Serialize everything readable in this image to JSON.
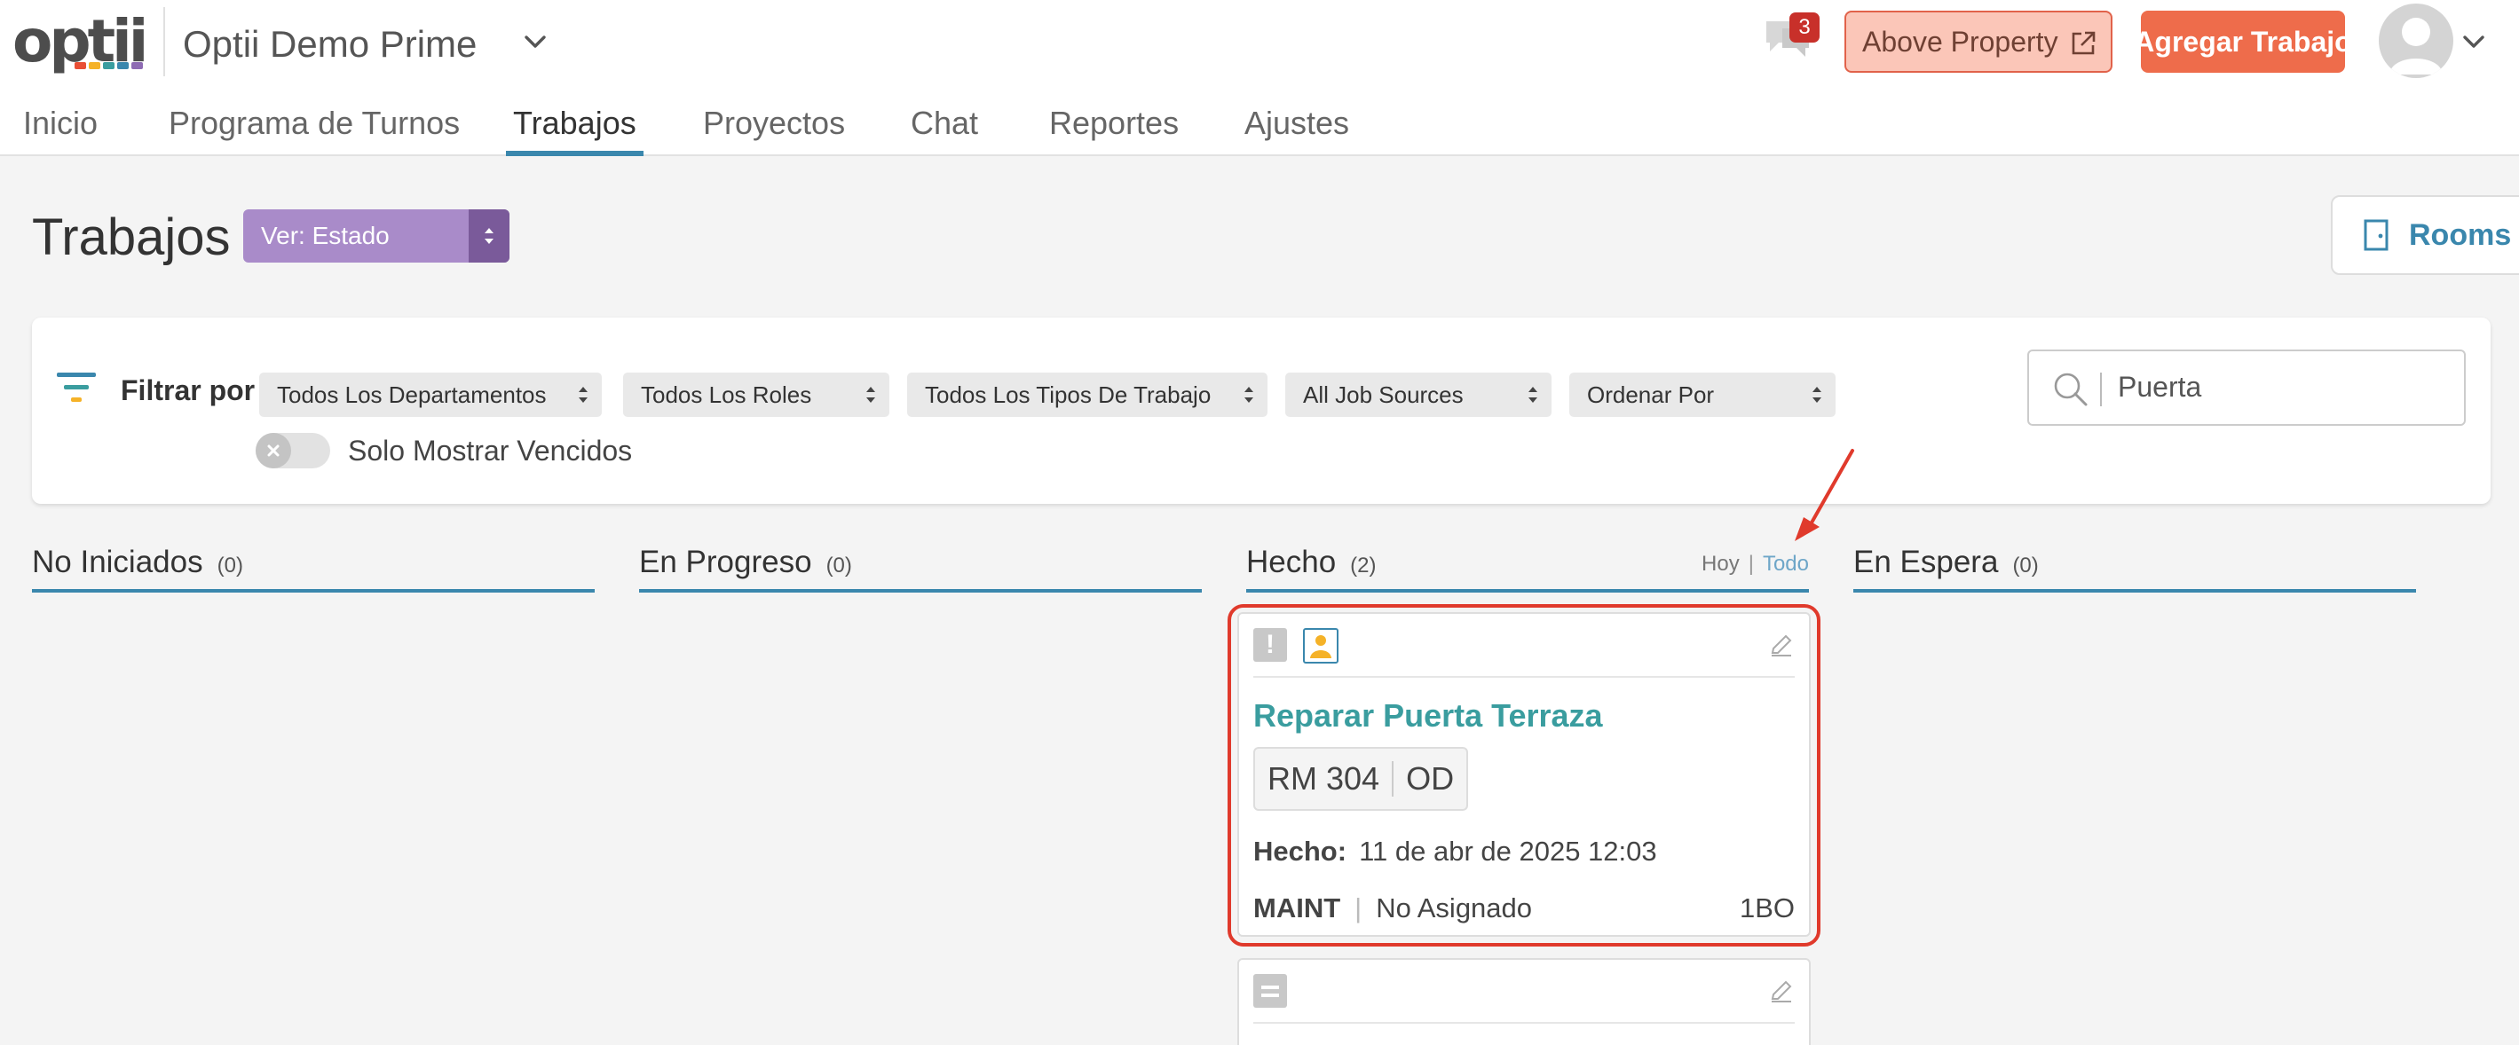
{
  "header": {
    "logo_text": "optii",
    "logo_colors": [
      "#e94f35",
      "#f5b228",
      "#3a9d9f",
      "#3a87ad",
      "#8e6bb3"
    ],
    "property_name": "Optii Demo Prime",
    "chat_badge_count": "3",
    "above_property_label": "Above Property",
    "add_job_label": "Agregar Trabajo"
  },
  "nav": {
    "items": [
      "Inicio",
      "Programa de Turnos",
      "Trabajos",
      "Proyectos",
      "Chat",
      "Reportes",
      "Ajustes"
    ],
    "active": "Trabajos"
  },
  "page": {
    "title": "Trabajos",
    "view_select": "Ver: Estado",
    "rooms_label": "Rooms"
  },
  "filters": {
    "label": "Filtrar por",
    "selects": [
      "Todos Los Departamentos",
      "Todos Los Roles",
      "Todos Los Tipos De Trabajo",
      "All Job Sources",
      "Ordenar Por"
    ],
    "overdue_toggle_label": "Solo Mostrar Vencidos",
    "overdue_toggle_on": false,
    "search_value": "Puerta"
  },
  "columns": [
    {
      "title": "No Iniciados",
      "count": "(0)"
    },
    {
      "title": "En Progreso",
      "count": "(0)"
    },
    {
      "title": "Hecho",
      "count": "(2)",
      "link_today": "Hoy",
      "link_separator": "|",
      "link_all": "Todo"
    },
    {
      "title": "En Espera",
      "count": "(0)"
    }
  ],
  "cards": [
    {
      "title": "Reparar Puerta Terraza",
      "room": "RM 304",
      "room_status": "OD",
      "done_label": "Hecho:",
      "done_value": "11 de abr de 2025 12:03",
      "department": "MAINT",
      "pipe": "|",
      "assignee": "No Asignado",
      "code": "1BO"
    }
  ],
  "colors": {
    "accent_blue": "#3a87ad",
    "card_title_teal": "#3a9d9f",
    "orange": "#ee6c4b",
    "highlight_red": "#e03a2c",
    "view_select_purple": "#a98bc9"
  }
}
